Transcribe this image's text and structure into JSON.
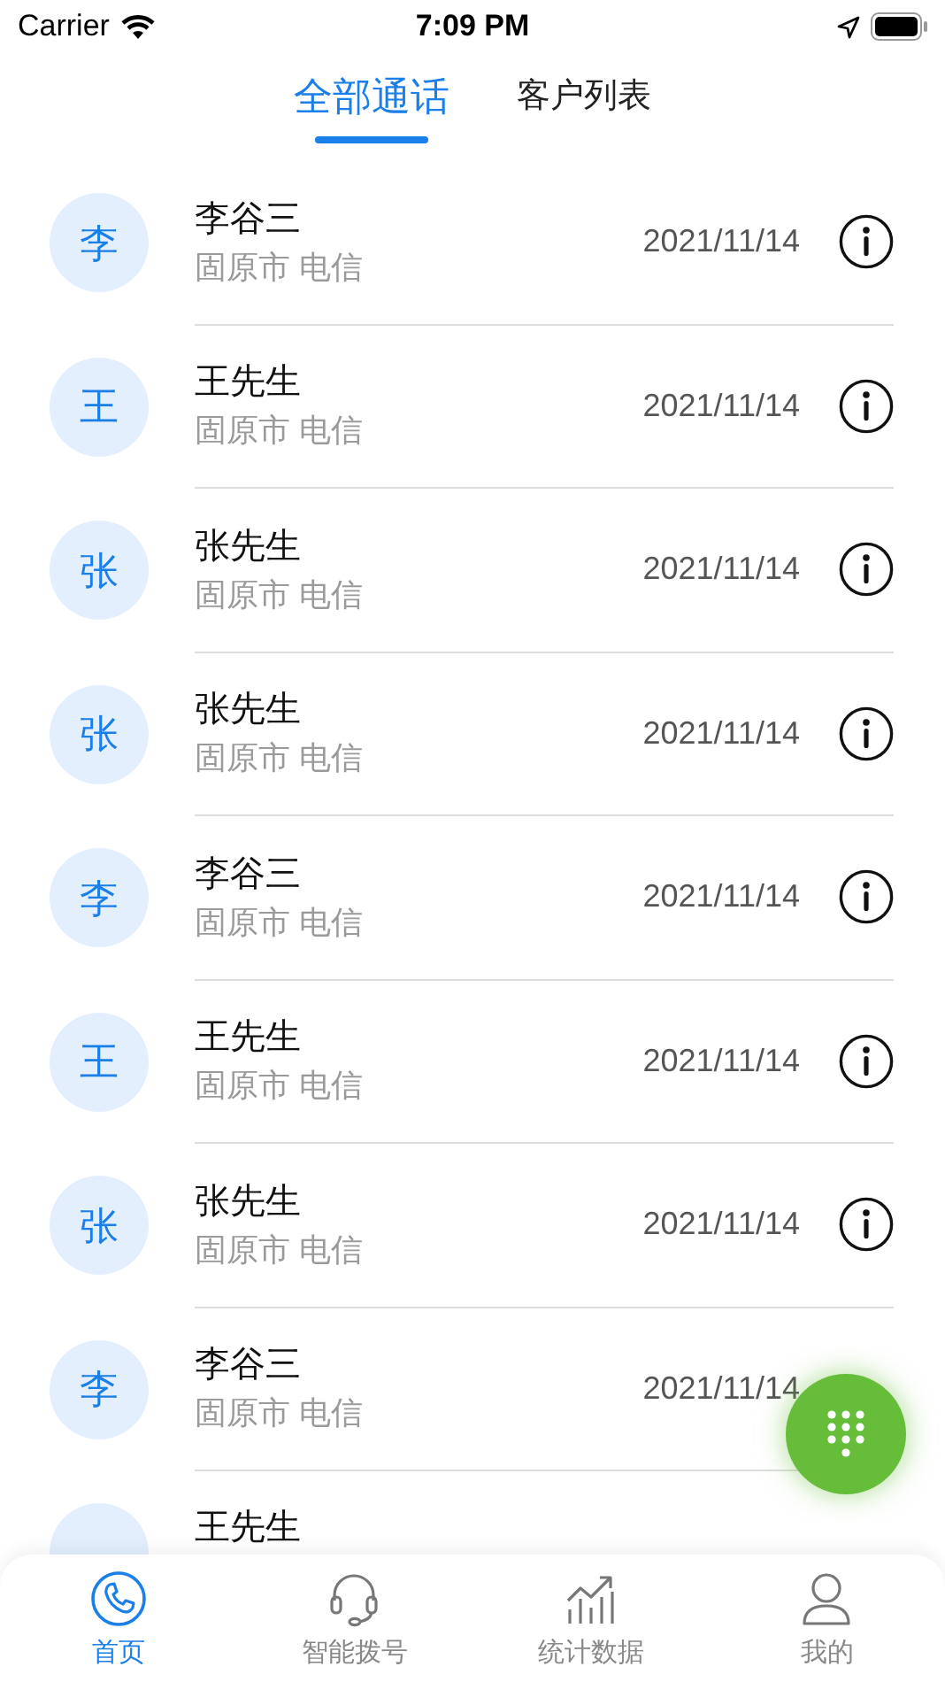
{
  "status_bar": {
    "carrier": "Carrier",
    "time": "7:09 PM"
  },
  "tabs": [
    {
      "label": "全部通话",
      "selected": true
    },
    {
      "label": "客户列表",
      "selected": false
    }
  ],
  "calls": [
    {
      "avatar": "李",
      "name": "李谷三",
      "location": "固原市 电信",
      "date": "2021/11/14"
    },
    {
      "avatar": "王",
      "name": "王先生",
      "location": "固原市 电信",
      "date": "2021/11/14"
    },
    {
      "avatar": "张",
      "name": "张先生",
      "location": "固原市 电信",
      "date": "2021/11/14"
    },
    {
      "avatar": "张",
      "name": "张先生",
      "location": "固原市 电信",
      "date": "2021/11/14"
    },
    {
      "avatar": "李",
      "name": "李谷三",
      "location": "固原市 电信",
      "date": "2021/11/14"
    },
    {
      "avatar": "王",
      "name": "王先生",
      "location": "固原市 电信",
      "date": "2021/11/14"
    },
    {
      "avatar": "张",
      "name": "张先生",
      "location": "固原市 电信",
      "date": "2021/11/14"
    },
    {
      "kind": "covered",
      "avatar": "李",
      "name": "李谷三",
      "location": "固原市 电信",
      "date": "2021/11/14"
    },
    {
      "kind": "partial",
      "name": "王先生"
    }
  ],
  "bottom_nav": [
    {
      "kind": "phone",
      "label": "首页",
      "selected": true
    },
    {
      "kind": "headset",
      "label": "智能拨号",
      "selected": false
    },
    {
      "kind": "chart",
      "label": "统计数据",
      "selected": false
    },
    {
      "kind": "person",
      "label": "我的",
      "selected": false
    }
  ]
}
